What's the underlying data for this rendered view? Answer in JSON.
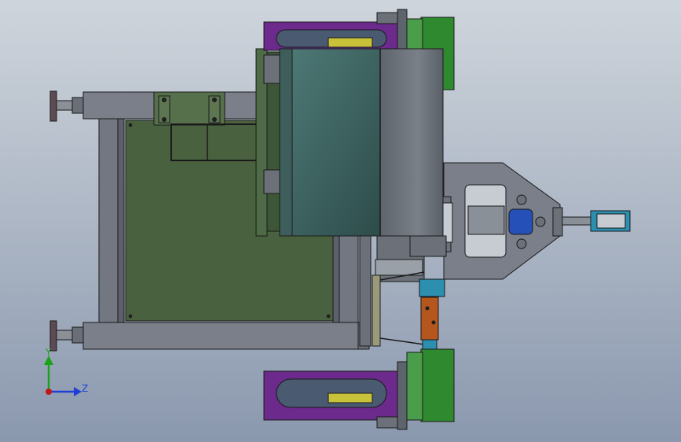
{
  "viewport": {
    "background_top": "#cfd5dc",
    "background_bottom": "#8a98ae"
  },
  "triad": {
    "y_label": "Y",
    "z_label": "Z",
    "y_color": "#1aa21a",
    "z_color": "#1f3fd6",
    "origin_color": "#c01818"
  },
  "colors": {
    "frame": "#7a7f89",
    "frame_dark": "#5b6069",
    "panel": "#4a6140",
    "panel_light": "#56704b",
    "drum_teal": "#3f6664",
    "drum_cap": "#6d737b",
    "purple": "#6b2a8c",
    "green": "#2f8a2f",
    "yellow": "#c8c23a",
    "blue_nut": "#2450b8",
    "cyan_cyl": "#2c8fb0",
    "orange": "#b4561e",
    "outline": "#1a1a1a"
  }
}
